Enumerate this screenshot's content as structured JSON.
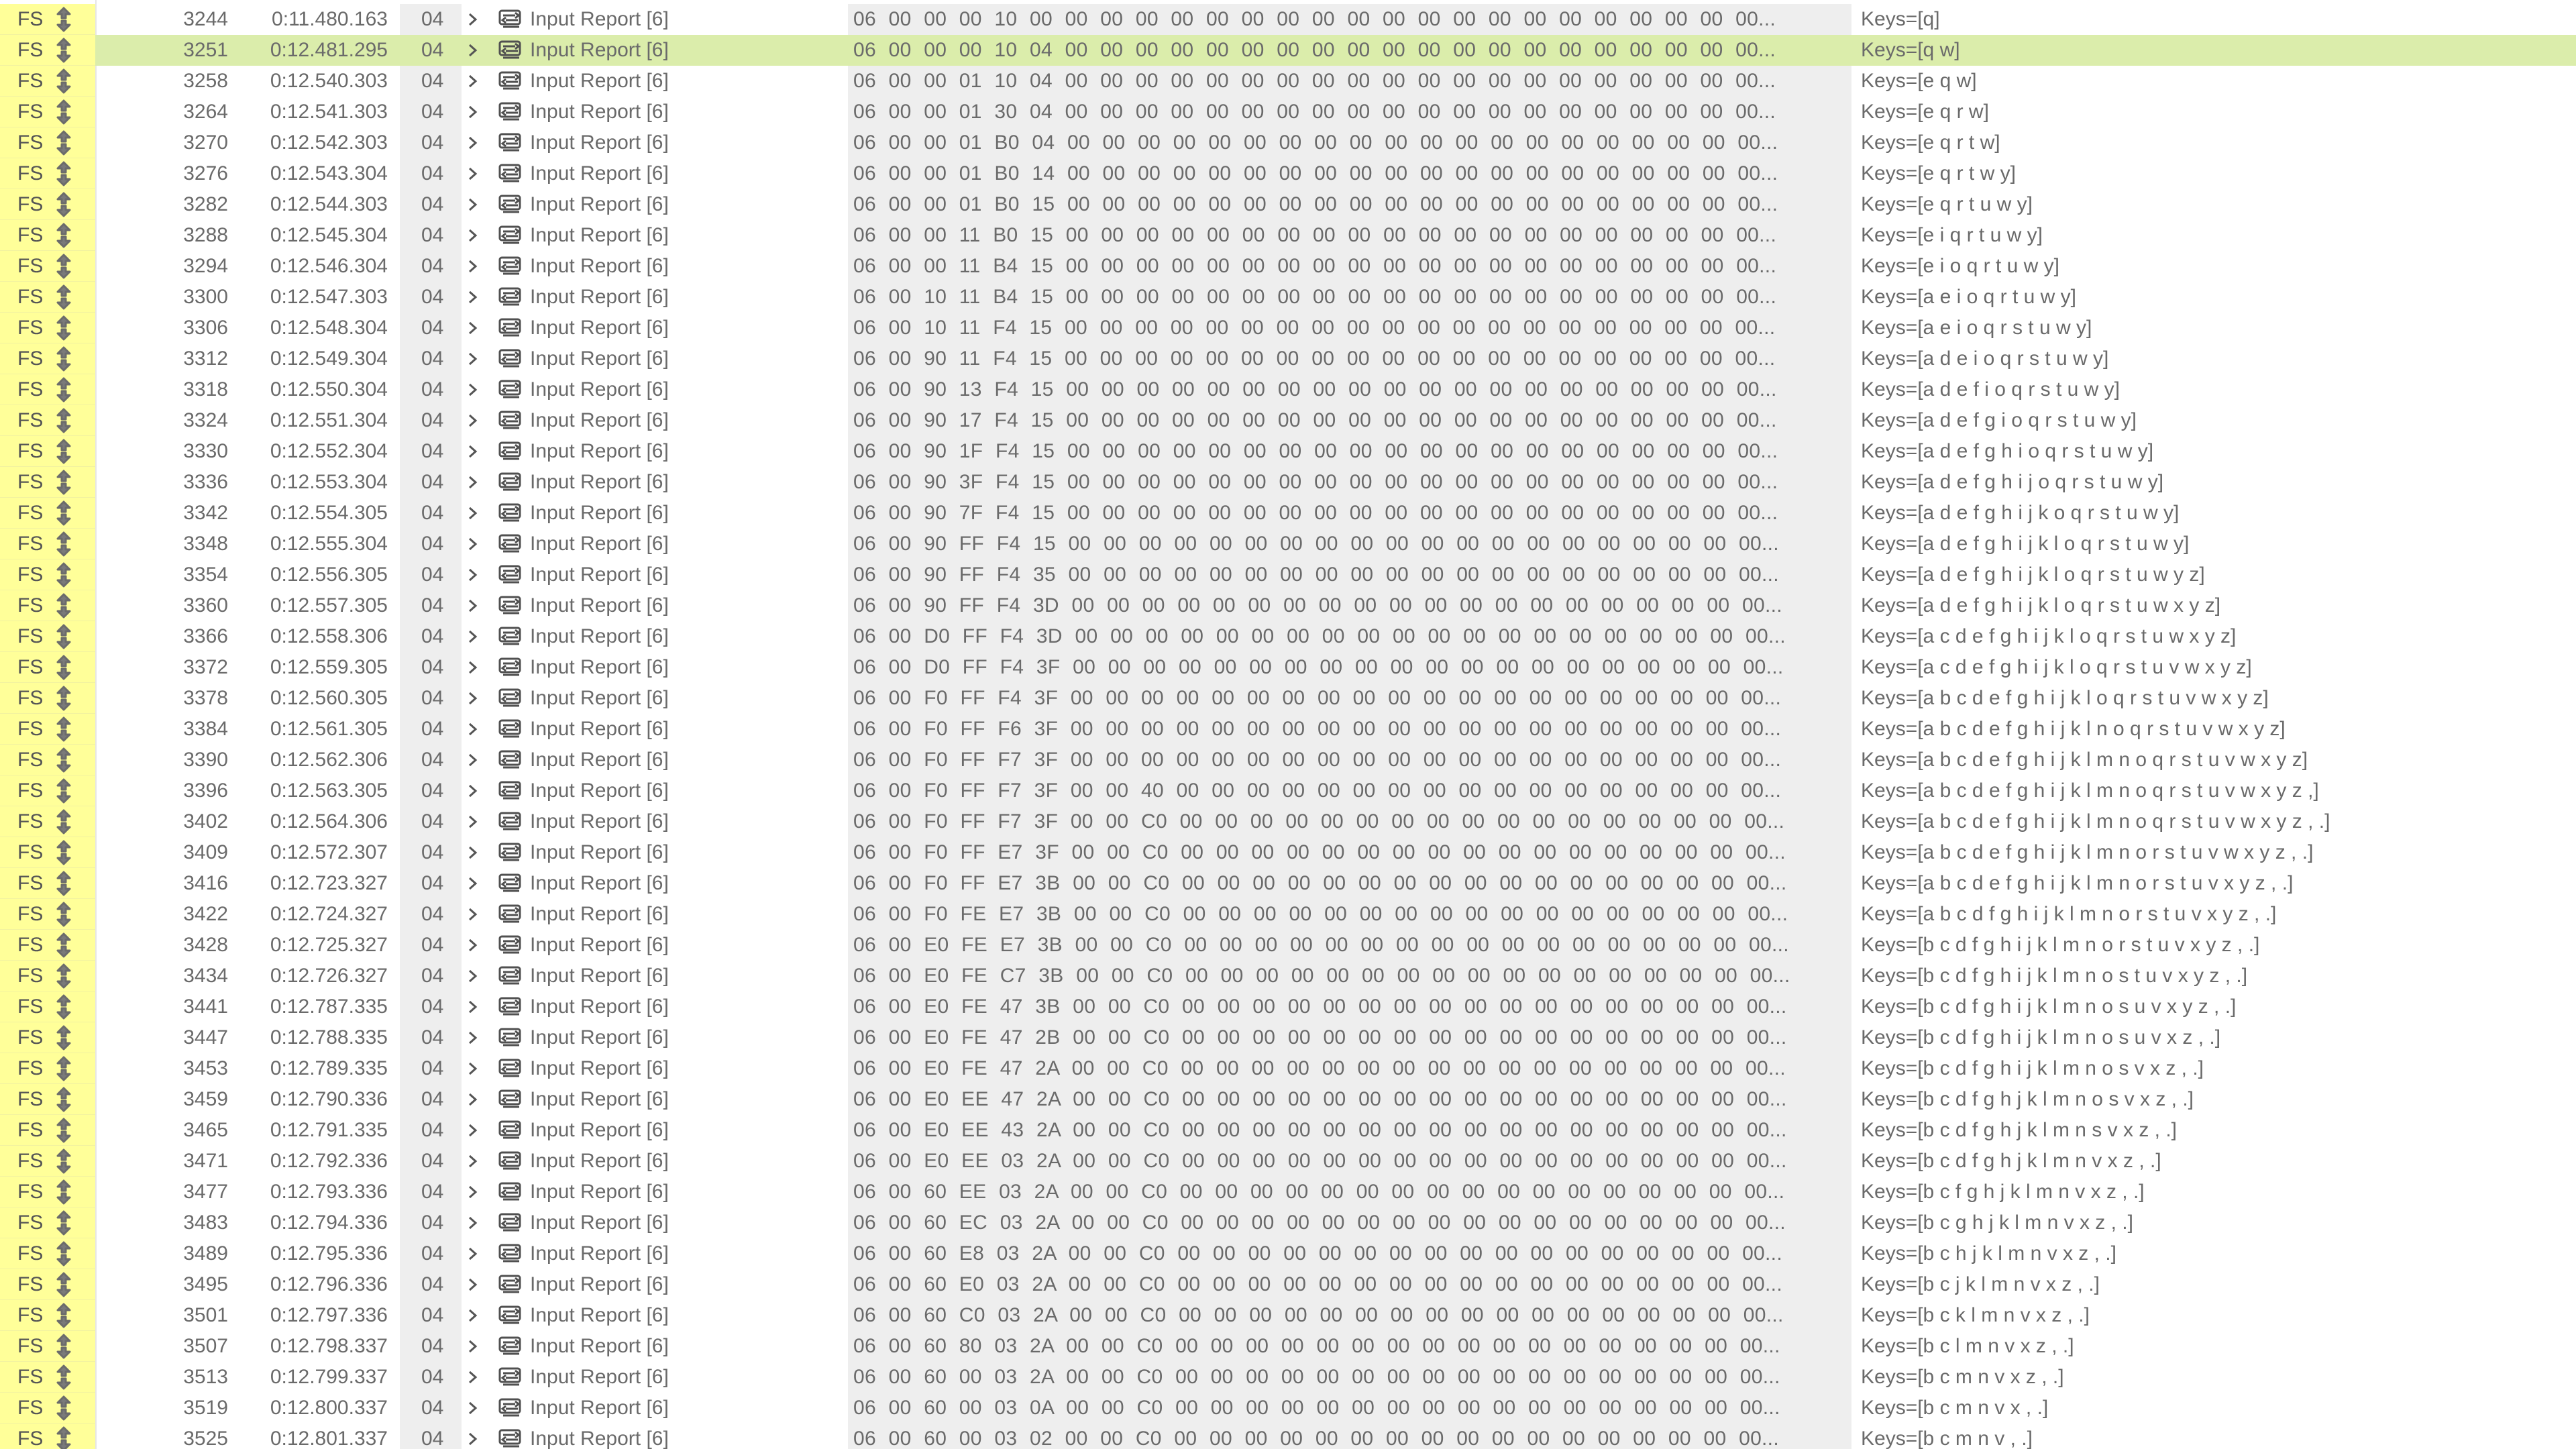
{
  "window": {
    "speed_label": "FS",
    "device_label": "04",
    "description_label": "Input Report [6]"
  },
  "rows": [
    {
      "index": "3244",
      "time": "0:11.480.163",
      "data": "06 00 00 00 10 00 00 00 00 00 00 00 00 00 00 00 00 00 00 00 00 00 00 00 00 00...",
      "summary": "Keys=[q]"
    },
    {
      "index": "3251",
      "time": "0:12.481.295",
      "data": "06 00 00 00 10 04 00 00 00 00 00 00 00 00 00 00 00 00 00 00 00 00 00 00 00 00...",
      "summary": "Keys=[q w]",
      "selected": true
    },
    {
      "index": "3258",
      "time": "0:12.540.303",
      "data": "06 00 00 01 10 04 00 00 00 00 00 00 00 00 00 00 00 00 00 00 00 00 00 00 00 00...",
      "summary": "Keys=[e q w]"
    },
    {
      "index": "3264",
      "time": "0:12.541.303",
      "data": "06 00 00 01 30 04 00 00 00 00 00 00 00 00 00 00 00 00 00 00 00 00 00 00 00 00...",
      "summary": "Keys=[e q r w]"
    },
    {
      "index": "3270",
      "time": "0:12.542.303",
      "data": "06 00 00 01 B0 04 00 00 00 00 00 00 00 00 00 00 00 00 00 00 00 00 00 00 00 00...",
      "summary": "Keys=[e q r t w]"
    },
    {
      "index": "3276",
      "time": "0:12.543.304",
      "data": "06 00 00 01 B0 14 00 00 00 00 00 00 00 00 00 00 00 00 00 00 00 00 00 00 00 00...",
      "summary": "Keys=[e q r t w y]"
    },
    {
      "index": "3282",
      "time": "0:12.544.303",
      "data": "06 00 00 01 B0 15 00 00 00 00 00 00 00 00 00 00 00 00 00 00 00 00 00 00 00 00...",
      "summary": "Keys=[e q r t u w y]"
    },
    {
      "index": "3288",
      "time": "0:12.545.304",
      "data": "06 00 00 11 B0 15 00 00 00 00 00 00 00 00 00 00 00 00 00 00 00 00 00 00 00 00...",
      "summary": "Keys=[e i q r t u w y]"
    },
    {
      "index": "3294",
      "time": "0:12.546.304",
      "data": "06 00 00 11 B4 15 00 00 00 00 00 00 00 00 00 00 00 00 00 00 00 00 00 00 00 00...",
      "summary": "Keys=[e i o q r t u w y]"
    },
    {
      "index": "3300",
      "time": "0:12.547.303",
      "data": "06 00 10 11 B4 15 00 00 00 00 00 00 00 00 00 00 00 00 00 00 00 00 00 00 00 00...",
      "summary": "Keys=[a e i o q r t u w y]"
    },
    {
      "index": "3306",
      "time": "0:12.548.304",
      "data": "06 00 10 11 F4 15 00 00 00 00 00 00 00 00 00 00 00 00 00 00 00 00 00 00 00 00...",
      "summary": "Keys=[a e i o q r s t u w y]"
    },
    {
      "index": "3312",
      "time": "0:12.549.304",
      "data": "06 00 90 11 F4 15 00 00 00 00 00 00 00 00 00 00 00 00 00 00 00 00 00 00 00 00...",
      "summary": "Keys=[a d e i o q r s t u w y]"
    },
    {
      "index": "3318",
      "time": "0:12.550.304",
      "data": "06 00 90 13 F4 15 00 00 00 00 00 00 00 00 00 00 00 00 00 00 00 00 00 00 00 00...",
      "summary": "Keys=[a d e f i o q r s t u w y]"
    },
    {
      "index": "3324",
      "time": "0:12.551.304",
      "data": "06 00 90 17 F4 15 00 00 00 00 00 00 00 00 00 00 00 00 00 00 00 00 00 00 00 00...",
      "summary": "Keys=[a d e f g i o q r s t u w y]"
    },
    {
      "index": "3330",
      "time": "0:12.552.304",
      "data": "06 00 90 1F F4 15 00 00 00 00 00 00 00 00 00 00 00 00 00 00 00 00 00 00 00 00...",
      "summary": "Keys=[a d e f g h i o q r s t u w y]"
    },
    {
      "index": "3336",
      "time": "0:12.553.304",
      "data": "06 00 90 3F F4 15 00 00 00 00 00 00 00 00 00 00 00 00 00 00 00 00 00 00 00 00...",
      "summary": "Keys=[a d e f g h i j o q r s t u w y]"
    },
    {
      "index": "3342",
      "time": "0:12.554.305",
      "data": "06 00 90 7F F4 15 00 00 00 00 00 00 00 00 00 00 00 00 00 00 00 00 00 00 00 00...",
      "summary": "Keys=[a d e f g h i j k o q r s t u w y]"
    },
    {
      "index": "3348",
      "time": "0:12.555.304",
      "data": "06 00 90 FF F4 15 00 00 00 00 00 00 00 00 00 00 00 00 00 00 00 00 00 00 00 00...",
      "summary": "Keys=[a d e f g h i j k l o q r s t u w y]"
    },
    {
      "index": "3354",
      "time": "0:12.556.305",
      "data": "06 00 90 FF F4 35 00 00 00 00 00 00 00 00 00 00 00 00 00 00 00 00 00 00 00 00...",
      "summary": "Keys=[a d e f g h i j k l o q r s t u w y z]"
    },
    {
      "index": "3360",
      "time": "0:12.557.305",
      "data": "06 00 90 FF F4 3D 00 00 00 00 00 00 00 00 00 00 00 00 00 00 00 00 00 00 00 00...",
      "summary": "Keys=[a d e f g h i j k l o q r s t u w x y z]"
    },
    {
      "index": "3366",
      "time": "0:12.558.306",
      "data": "06 00 D0 FF F4 3D 00 00 00 00 00 00 00 00 00 00 00 00 00 00 00 00 00 00 00 00...",
      "summary": "Keys=[a c d e f g h i j k l o q r s t u w x y z]"
    },
    {
      "index": "3372",
      "time": "0:12.559.305",
      "data": "06 00 D0 FF F4 3F 00 00 00 00 00 00 00 00 00 00 00 00 00 00 00 00 00 00 00 00...",
      "summary": "Keys=[a c d e f g h i j k l o q r s t u v w x y z]"
    },
    {
      "index": "3378",
      "time": "0:12.560.305",
      "data": "06 00 F0 FF F4 3F 00 00 00 00 00 00 00 00 00 00 00 00 00 00 00 00 00 00 00 00...",
      "summary": "Keys=[a b c d e f g h i j k l o q r s t u v w x y z]"
    },
    {
      "index": "3384",
      "time": "0:12.561.305",
      "data": "06 00 F0 FF F6 3F 00 00 00 00 00 00 00 00 00 00 00 00 00 00 00 00 00 00 00 00...",
      "summary": "Keys=[a b c d e f g h i j k l n o q r s t u v w x y z]"
    },
    {
      "index": "3390",
      "time": "0:12.562.306",
      "data": "06 00 F0 FF F7 3F 00 00 00 00 00 00 00 00 00 00 00 00 00 00 00 00 00 00 00 00...",
      "summary": "Keys=[a b c d e f g h i j k l m n o q r s t u v w x y z]"
    },
    {
      "index": "3396",
      "time": "0:12.563.305",
      "data": "06 00 F0 FF F7 3F 00 00 40 00 00 00 00 00 00 00 00 00 00 00 00 00 00 00 00 00...",
      "summary": "Keys=[a b c d e f g h i j k l m n o q r s t u v w x y z ,]"
    },
    {
      "index": "3402",
      "time": "0:12.564.306",
      "data": "06 00 F0 FF F7 3F 00 00 C0 00 00 00 00 00 00 00 00 00 00 00 00 00 00 00 00 00...",
      "summary": "Keys=[a b c d e f g h i j k l m n o q r s t u v w x y z , .]"
    },
    {
      "index": "3409",
      "time": "0:12.572.307",
      "data": "06 00 F0 FF E7 3F 00 00 C0 00 00 00 00 00 00 00 00 00 00 00 00 00 00 00 00 00...",
      "summary": "Keys=[a b c d e f g h i j k l m n o r s t u v w x y z , .]"
    },
    {
      "index": "3416",
      "time": "0:12.723.327",
      "data": "06 00 F0 FF E7 3B 00 00 C0 00 00 00 00 00 00 00 00 00 00 00 00 00 00 00 00 00...",
      "summary": "Keys=[a b c d e f g h i j k l m n o r s t u v x y z , .]"
    },
    {
      "index": "3422",
      "time": "0:12.724.327",
      "data": "06 00 F0 FE E7 3B 00 00 C0 00 00 00 00 00 00 00 00 00 00 00 00 00 00 00 00 00...",
      "summary": "Keys=[a b c d f g h i j k l m n o r s t u v x y z , .]"
    },
    {
      "index": "3428",
      "time": "0:12.725.327",
      "data": "06 00 E0 FE E7 3B 00 00 C0 00 00 00 00 00 00 00 00 00 00 00 00 00 00 00 00 00...",
      "summary": "Keys=[b c d f g h i j k l m n o r s t u v x y z , .]"
    },
    {
      "index": "3434",
      "time": "0:12.726.327",
      "data": "06 00 E0 FE C7 3B 00 00 C0 00 00 00 00 00 00 00 00 00 00 00 00 00 00 00 00 00...",
      "summary": "Keys=[b c d f g h i j k l m n o s t u v x y z , .]"
    },
    {
      "index": "3441",
      "time": "0:12.787.335",
      "data": "06 00 E0 FE 47 3B 00 00 C0 00 00 00 00 00 00 00 00 00 00 00 00 00 00 00 00 00...",
      "summary": "Keys=[b c d f g h i j k l m n o s u v x y z , .]"
    },
    {
      "index": "3447",
      "time": "0:12.788.335",
      "data": "06 00 E0 FE 47 2B 00 00 C0 00 00 00 00 00 00 00 00 00 00 00 00 00 00 00 00 00...",
      "summary": "Keys=[b c d f g h i j k l m n o s u v x z , .]"
    },
    {
      "index": "3453",
      "time": "0:12.789.335",
      "data": "06 00 E0 FE 47 2A 00 00 C0 00 00 00 00 00 00 00 00 00 00 00 00 00 00 00 00 00...",
      "summary": "Keys=[b c d f g h i j k l m n o s v x z , .]"
    },
    {
      "index": "3459",
      "time": "0:12.790.336",
      "data": "06 00 E0 EE 47 2A 00 00 C0 00 00 00 00 00 00 00 00 00 00 00 00 00 00 00 00 00...",
      "summary": "Keys=[b c d f g h j k l m n o s v x z , .]"
    },
    {
      "index": "3465",
      "time": "0:12.791.335",
      "data": "06 00 E0 EE 43 2A 00 00 C0 00 00 00 00 00 00 00 00 00 00 00 00 00 00 00 00 00...",
      "summary": "Keys=[b c d f g h j k l m n s v x z , .]"
    },
    {
      "index": "3471",
      "time": "0:12.792.336",
      "data": "06 00 E0 EE 03 2A 00 00 C0 00 00 00 00 00 00 00 00 00 00 00 00 00 00 00 00 00...",
      "summary": "Keys=[b c d f g h j k l m n v x z , .]"
    },
    {
      "index": "3477",
      "time": "0:12.793.336",
      "data": "06 00 60 EE 03 2A 00 00 C0 00 00 00 00 00 00 00 00 00 00 00 00 00 00 00 00 00...",
      "summary": "Keys=[b c f g h j k l m n v x z , .]"
    },
    {
      "index": "3483",
      "time": "0:12.794.336",
      "data": "06 00 60 EC 03 2A 00 00 C0 00 00 00 00 00 00 00 00 00 00 00 00 00 00 00 00 00...",
      "summary": "Keys=[b c g h j k l m n v x z , .]"
    },
    {
      "index": "3489",
      "time": "0:12.795.336",
      "data": "06 00 60 E8 03 2A 00 00 C0 00 00 00 00 00 00 00 00 00 00 00 00 00 00 00 00 00...",
      "summary": "Keys=[b c h j k l m n v x z , .]"
    },
    {
      "index": "3495",
      "time": "0:12.796.336",
      "data": "06 00 60 E0 03 2A 00 00 C0 00 00 00 00 00 00 00 00 00 00 00 00 00 00 00 00 00...",
      "summary": "Keys=[b c j k l m n v x z , .]"
    },
    {
      "index": "3501",
      "time": "0:12.797.336",
      "data": "06 00 60 C0 03 2A 00 00 C0 00 00 00 00 00 00 00 00 00 00 00 00 00 00 00 00 00...",
      "summary": "Keys=[b c k l m n v x z , .]"
    },
    {
      "index": "3507",
      "time": "0:12.798.337",
      "data": "06 00 60 80 03 2A 00 00 C0 00 00 00 00 00 00 00 00 00 00 00 00 00 00 00 00 00...",
      "summary": "Keys=[b c l m n v x z , .]"
    },
    {
      "index": "3513",
      "time": "0:12.799.337",
      "data": "06 00 60 00 03 2A 00 00 C0 00 00 00 00 00 00 00 00 00 00 00 00 00 00 00 00 00...",
      "summary": "Keys=[b c m n v x z , .]"
    },
    {
      "index": "3519",
      "time": "0:12.800.337",
      "data": "06 00 60 00 03 0A 00 00 C0 00 00 00 00 00 00 00 00 00 00 00 00 00 00 00 00 00...",
      "summary": "Keys=[b c m n v x , .]"
    },
    {
      "index": "3525",
      "time": "0:12.801.337",
      "data": "06 00 60 00 03 02 00 00 C0 00 00 00 00 00 00 00 00 00 00 00 00 00 00 00 00 00...",
      "summary": "Keys=[b c m n v , .]"
    }
  ]
}
